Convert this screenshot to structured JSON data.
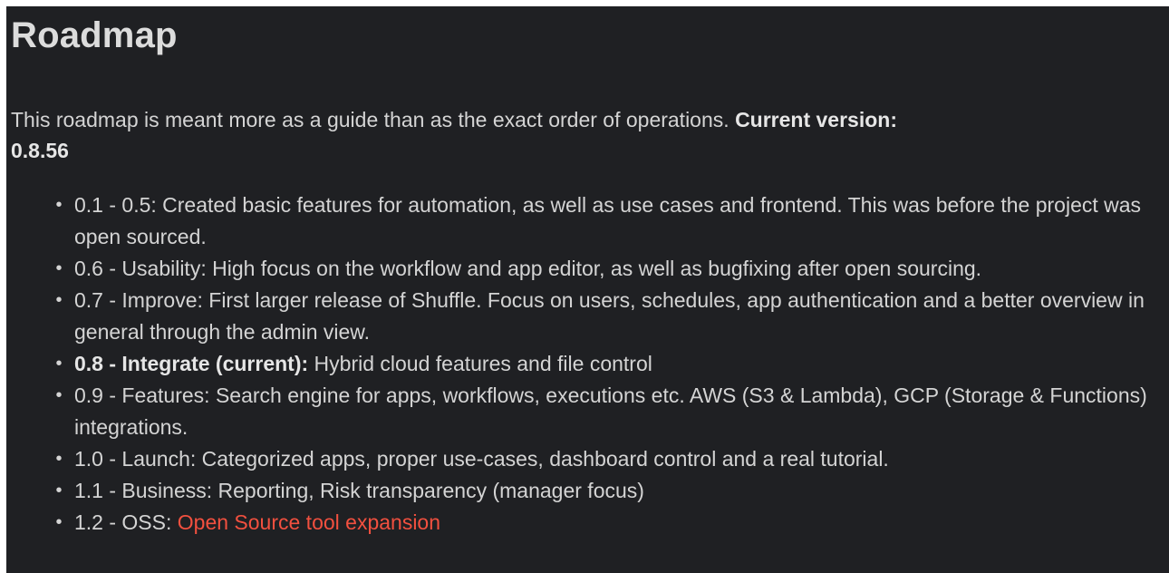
{
  "heading": "Roadmap",
  "intro": {
    "text": "This roadmap is meant more as a guide than as the exact order of operations. ",
    "current_label": "Current version:",
    "current_version": "0.8.56"
  },
  "items": [
    {
      "text": "0.1 - 0.5: Created basic features for automation, as well as use cases and frontend. This was before the project was open sourced."
    },
    {
      "text": "0.6 - Usability: High focus on the workflow and app editor, as well as bugfixing after open sourcing."
    },
    {
      "text": "0.7 - Improve: First larger release of Shuffle. Focus on users, schedules, app authentication and a better overview in general through the admin view."
    },
    {
      "strong": "0.8 - Integrate (current):",
      "text": " Hybrid cloud features and file control"
    },
    {
      "text": "0.9 - Features: Search engine for apps, workflows, executions etc. AWS (S3 & Lambda), GCP (Storage & Functions) integrations."
    },
    {
      "text": "1.0 - Launch: Categorized apps, proper use-cases, dashboard control and a real tutorial."
    },
    {
      "text": "1.1 - Business: Reporting, Risk transparency (manager focus)"
    },
    {
      "text": "1.2 - OSS: ",
      "link": "Open Source tool expansion"
    }
  ],
  "colors": {
    "background": "#1f2023",
    "text": "#d4d4d4",
    "link": "#f2503f"
  }
}
